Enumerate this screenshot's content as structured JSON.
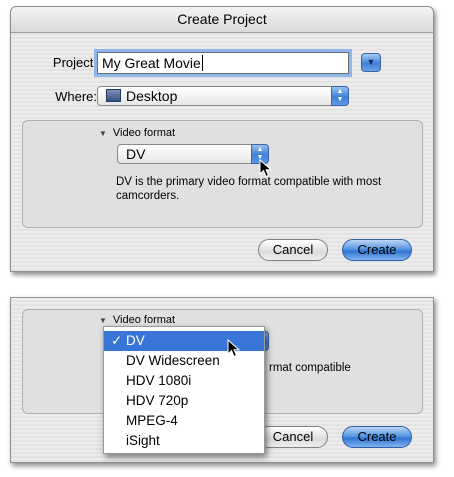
{
  "dialog": {
    "title": "Create Project",
    "project_label": "Project:",
    "project_value": "My Great Movie",
    "where_label": "Where:",
    "where_value": "Desktop",
    "where_icon": "desktop-folder-icon",
    "disclosure_label": "Video format",
    "format_value": "DV",
    "description": "DV is the primary video format compatible with most camcorders.",
    "cancel_label": "Cancel",
    "create_label": "Create"
  },
  "menu_panel": {
    "disclosure_label": "Video format",
    "description_line1_tail": "rmat compatible",
    "check_mark": "✓",
    "options": [
      "DV",
      "DV Widescreen",
      "HDV 1080i",
      "HDV 720p",
      "MPEG-4",
      "iSight"
    ],
    "selected_index": 0,
    "cancel_label": "Cancel",
    "create_label": "Create"
  },
  "colors": {
    "accent_blue": "#3875d7",
    "focus_ring": "#8fb6e8"
  }
}
